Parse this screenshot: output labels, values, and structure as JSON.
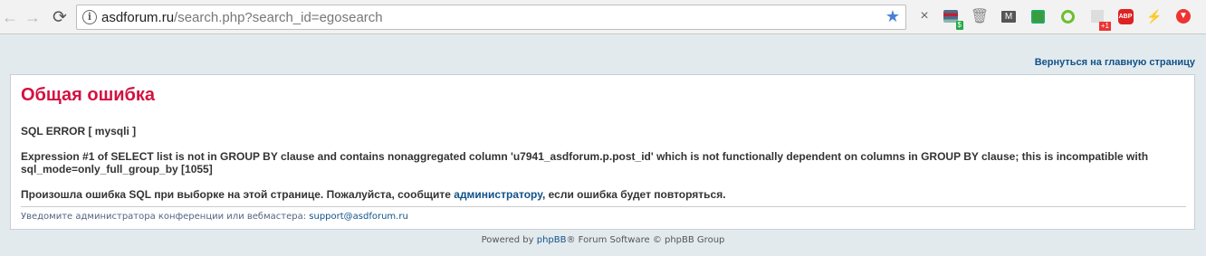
{
  "browser": {
    "url_host": "asdforum.ru",
    "url_path": "/search.php?search_id=egosearch",
    "back_icon": "←",
    "forward_icon": "→",
    "reload_icon": "⟳",
    "info_icon": "i",
    "star_icon": "★",
    "extensions": {
      "close_icon": "×",
      "wallet_badge": "$",
      "trash_icon": "🗑",
      "mail_icon": "M",
      "plus_badge": "+1",
      "abp_label": "ABP",
      "bolt_icon": "⚡",
      "down_icon": "▼"
    }
  },
  "page": {
    "back_link": "Вернуться на главную страницу",
    "error_title": "Общая ошибка",
    "sql_error": "SQL ERROR [ mysqli ]",
    "expression": "Expression #1 of SELECT list is not in GROUP BY clause and contains nonaggregated column 'u7941_asdforum.p.post_id' which is not functionally dependent on columns in GROUP BY clause; this is incompatible with sql_mode=only_full_group_by [1055]",
    "message_before": "Произошла ошибка SQL при выборке на этой странице. Пожалуйста, сообщите ",
    "message_link": "администратору",
    "message_after": ", если ошибка будет повторяться.",
    "notice_text": "Уведомите администратора конференции или вебмастера: ",
    "notice_email": "support@asdforum.ru"
  },
  "footer": {
    "before": "Powered by ",
    "link": "phpBB",
    "after": "® Forum Software © phpBB Group"
  },
  "colors": {
    "title": "#d31141",
    "link": "#105289",
    "background": "#e3eaee"
  }
}
